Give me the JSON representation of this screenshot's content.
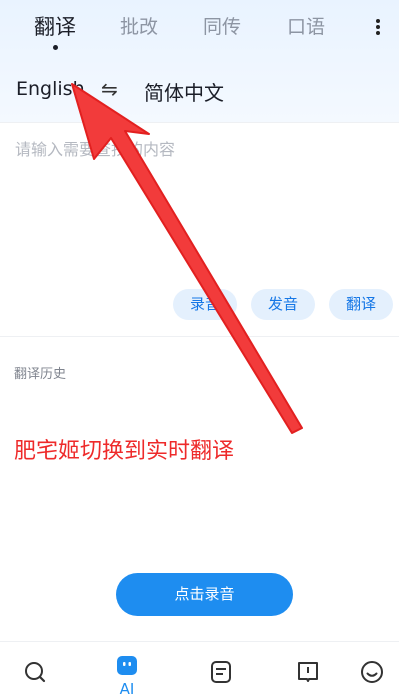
{
  "tabs": [
    {
      "label": "翻译",
      "active": true
    },
    {
      "label": "批改",
      "active": false
    },
    {
      "label": "同传",
      "active": false
    },
    {
      "label": "口语",
      "active": false
    }
  ],
  "language": {
    "source": "English",
    "swap_glyph": "⇋",
    "target": "简体中文"
  },
  "input": {
    "placeholder": "请输入需要查找的内容"
  },
  "actions": {
    "record": "录音",
    "pronounce": "发音",
    "translate": "翻译"
  },
  "history": {
    "title": "翻译历史"
  },
  "overlay": {
    "text": "肥宅姬切换到实时翻译",
    "color": "#ee2a2a"
  },
  "record_button": {
    "label": "点击录音"
  },
  "bottom_nav": {
    "items": [
      {
        "icon": "search-icon"
      },
      {
        "icon": "ai-robot-icon",
        "label": "AI",
        "active": true
      },
      {
        "icon": "document-icon"
      },
      {
        "icon": "book-icon"
      },
      {
        "icon": "smiley-icon"
      }
    ]
  },
  "colors": {
    "accent": "#1e8df0",
    "chip_bg": "#e4f0fd",
    "chip_text": "#1677e6"
  }
}
